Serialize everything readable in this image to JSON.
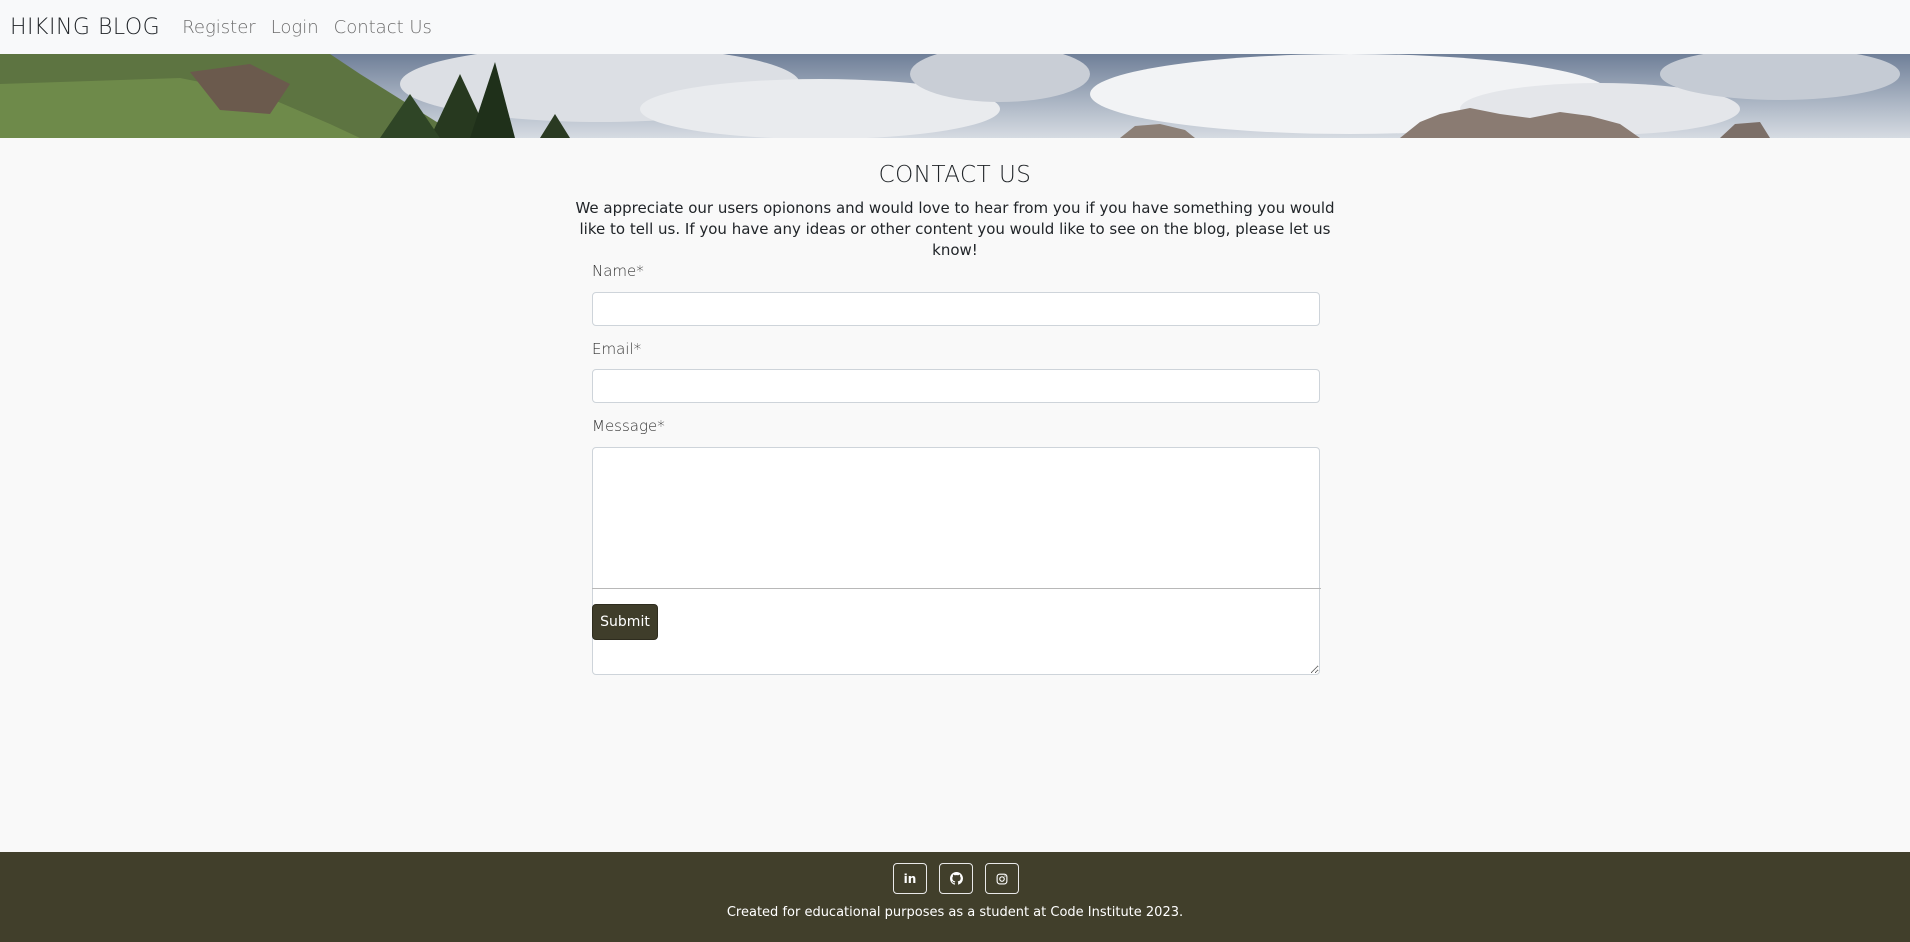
{
  "navbar": {
    "brand": "HIKING BLOG",
    "links": [
      "Register",
      "Login",
      "Contact Us"
    ]
  },
  "main": {
    "title": "CONTACT US",
    "intro": "We appreciate our users opionons and would love to hear from you if you have something you would like to tell us. If you have any ideas or other content you would like to see on the blog, please let us know!"
  },
  "form": {
    "name_label": "Name*",
    "name_value": "",
    "email_label": "Email*",
    "email_value": "",
    "message_label": "Message*",
    "message_value": "",
    "submit_label": "Submit"
  },
  "footer": {
    "icons": [
      "linkedin-icon",
      "github-icon",
      "instagram-icon"
    ],
    "linkedin_glyph": "in",
    "text": "Created for educational purposes as a student at Code Institute 2023."
  },
  "colors": {
    "primary": "#3f3d2a",
    "footer_bg": "#413f2b",
    "page_bg": "#f9f9f9",
    "navbar_bg": "#f8f9fa"
  }
}
